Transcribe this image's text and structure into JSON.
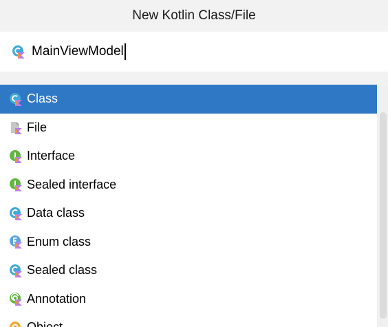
{
  "dialog": {
    "title": "New Kotlin Class/File"
  },
  "name_field": {
    "value": "MainViewModel",
    "icon": "kotlin-class-icon"
  },
  "kinds": [
    {
      "label": "Class",
      "icon": "kotlin-class-icon",
      "selected": true
    },
    {
      "label": "File",
      "icon": "kotlin-file-icon",
      "selected": false
    },
    {
      "label": "Interface",
      "icon": "kotlin-interface-icon",
      "selected": false
    },
    {
      "label": "Sealed interface",
      "icon": "kotlin-sealed-interface-icon",
      "selected": false
    },
    {
      "label": "Data class",
      "icon": "kotlin-data-class-icon",
      "selected": false
    },
    {
      "label": "Enum class",
      "icon": "kotlin-enum-class-icon",
      "selected": false
    },
    {
      "label": "Sealed class",
      "icon": "kotlin-sealed-class-icon",
      "selected": false
    },
    {
      "label": "Annotation",
      "icon": "kotlin-annotation-icon",
      "selected": false
    },
    {
      "label": "Object",
      "icon": "kotlin-object-icon",
      "selected": false
    }
  ],
  "colors": {
    "selection": "#2f78c6",
    "class_icon": "#40a9d8",
    "interface_icon": "#62b543",
    "enum_icon": "#5ba4e0",
    "annotation_icon": "#62b543",
    "object_icon": "#f2a83c",
    "kotlin_badge": "#b87cf0"
  }
}
